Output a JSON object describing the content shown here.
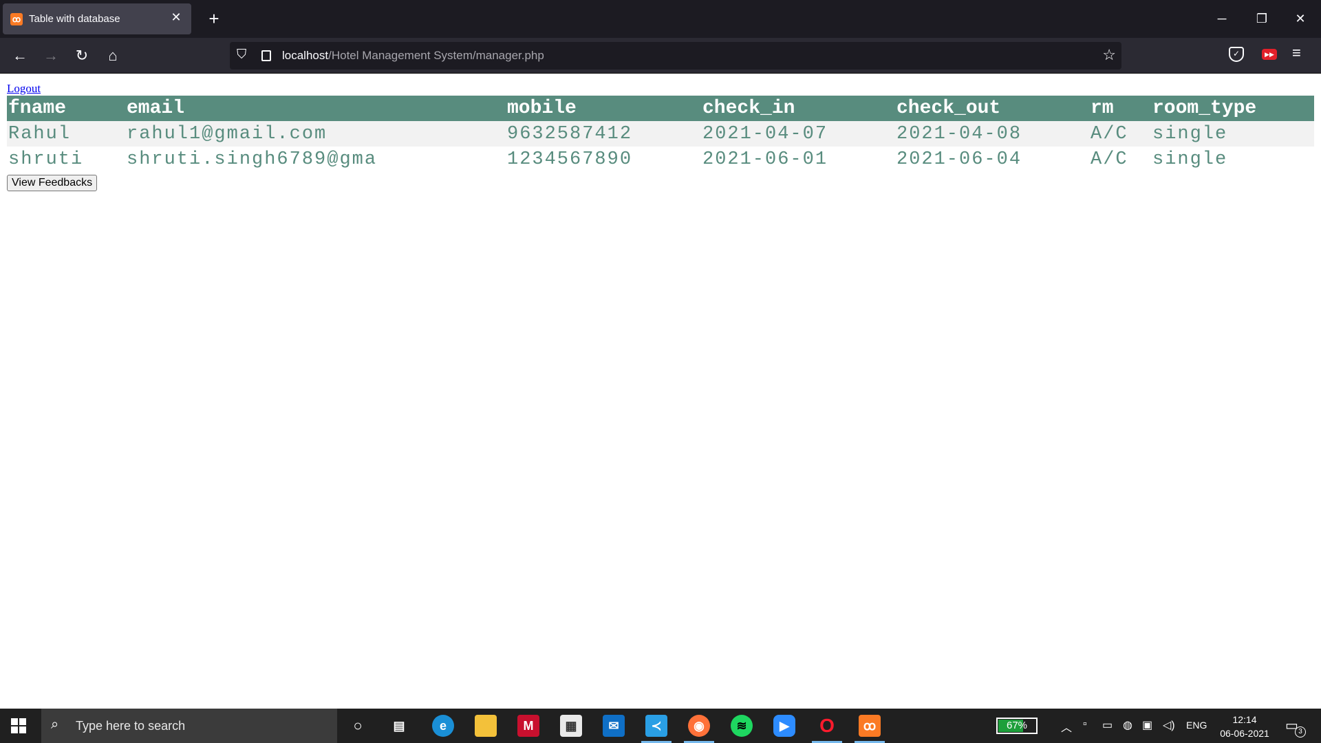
{
  "browser": {
    "tab_title": "Table with database",
    "tab_favicon": "ꝏ",
    "new_tab": "+",
    "url_host": "localhost",
    "url_path": "/Hotel Management System/manager.php",
    "window_controls": {
      "minimize": "─",
      "restore": "❐",
      "close": "✕"
    },
    "nav_icons": {
      "back": "←",
      "forward": "→",
      "reload": "↻",
      "home": "⌂",
      "shield": "⛉",
      "star": "☆",
      "menu": "≡"
    }
  },
  "page": {
    "logout_label": "Logout",
    "table": {
      "columns": [
        "fname",
        "email",
        "mobile",
        "check_in",
        "check_out",
        "rm",
        "room_type"
      ],
      "rows": [
        [
          "Rahul",
          "rahul1@gmail.com",
          "9632587412",
          "2021-04-07",
          "2021-04-08",
          "A/C",
          "single"
        ],
        [
          "shruti",
          "shruti.singh6789@gma",
          "1234567890",
          "2021-06-01",
          "2021-06-04",
          "A/C",
          "single"
        ]
      ],
      "header_color": "#588c7e",
      "text_color": "#588c7e"
    },
    "view_feedbacks_label": "View Feedbacks"
  },
  "taskbar": {
    "search_placeholder": "Type here to search",
    "battery_percent": "67%",
    "battery_level": 0.67,
    "language": "ENG",
    "time": "12:14",
    "date": "06-06-2021",
    "notification_count": "3",
    "apps": [
      "cortana-icon",
      "task-view-icon",
      "edge-icon",
      "file-explorer-icon",
      "mcafee-icon",
      "store-icon",
      "mail-icon",
      "vscode-icon",
      "firefox-icon",
      "spotify-icon",
      "zoom-icon",
      "opera-icon",
      "xampp-icon"
    ]
  }
}
